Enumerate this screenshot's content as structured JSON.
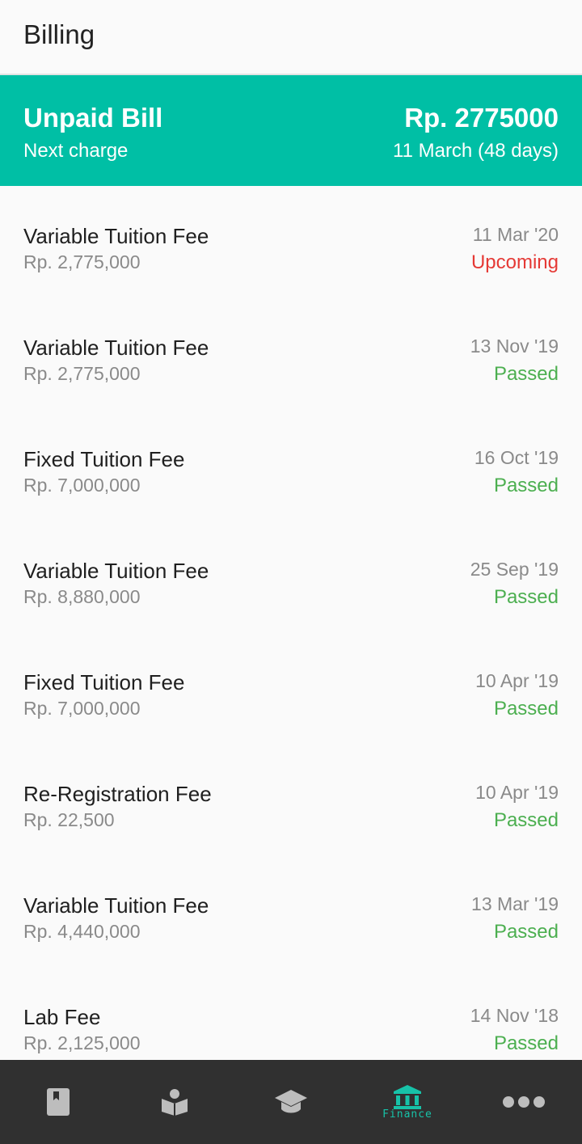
{
  "app": {
    "title": "Billing"
  },
  "summary": {
    "title": "Unpaid Bill",
    "subtitle": "Next charge",
    "amount": "Rp. 2775000",
    "next_date": "11 March (48 days)"
  },
  "bills": [
    {
      "name": "Variable Tuition Fee",
      "amount": "Rp. 2,775,000",
      "date": "11 Mar '20",
      "status": "Upcoming",
      "status_color": "#e53935"
    },
    {
      "name": "Variable Tuition Fee",
      "amount": "Rp. 2,775,000",
      "date": "13 Nov '19",
      "status": "Passed",
      "status_color": "#4caf50"
    },
    {
      "name": "Fixed Tuition Fee",
      "amount": "Rp. 7,000,000",
      "date": "16 Oct '19",
      "status": "Passed",
      "status_color": "#4caf50"
    },
    {
      "name": "Variable Tuition Fee",
      "amount": "Rp. 8,880,000",
      "date": "25 Sep '19",
      "status": "Passed",
      "status_color": "#4caf50"
    },
    {
      "name": "Fixed Tuition Fee",
      "amount": "Rp. 7,000,000",
      "date": "10 Apr '19",
      "status": "Passed",
      "status_color": "#4caf50"
    },
    {
      "name": "Re-Registration Fee",
      "amount": "Rp. 22,500",
      "date": "10 Apr '19",
      "status": "Passed",
      "status_color": "#4caf50"
    },
    {
      "name": "Variable Tuition Fee",
      "amount": "Rp. 4,440,000",
      "date": "13 Mar '19",
      "status": "Passed",
      "status_color": "#4caf50"
    },
    {
      "name": "Lab Fee",
      "amount": "Rp. 2,125,000",
      "date": "14 Nov '18",
      "status": "Passed",
      "status_color": "#4caf50"
    }
  ],
  "nav": {
    "items": [
      {
        "icon": "book-icon",
        "active": false
      },
      {
        "icon": "reader-icon",
        "active": false
      },
      {
        "icon": "graduation-cap-icon",
        "active": false
      },
      {
        "icon": "bank-icon",
        "label": "Finance",
        "active": true
      },
      {
        "icon": "more-icon",
        "active": false
      }
    ]
  },
  "colors": {
    "accent": "#00bfa5",
    "nav_bg": "#303030",
    "active_icon": "#17c2a8",
    "inactive_icon": "#bdbdbd"
  }
}
